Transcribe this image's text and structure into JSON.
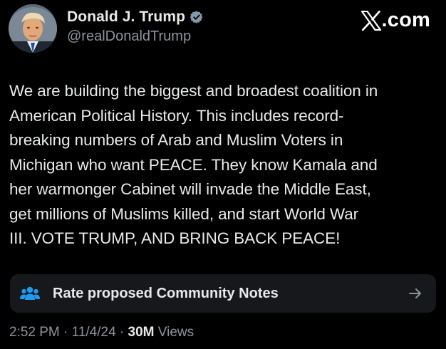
{
  "author": {
    "display_name": "Donald J. Trump",
    "handle": "@realDonaldTrump",
    "verified": true,
    "avatar_icon": "profile-photo"
  },
  "brand": {
    "label": ".com",
    "icon": "x-logo-icon"
  },
  "post": {
    "text": "We are building the biggest and broadest coalition in\nAmerican Political History. This includes record-\nbreaking numbers of Arab and Muslim Voters in\nMichigan who want PEACE. They know Kamala and\nher warmonger Cabinet will invade the Middle East,\nget millions of Muslims killed, and start World War\nIII. VOTE TRUMP, AND BRING BACK PEACE!"
  },
  "community_notes": {
    "label": "Rate proposed Community Notes",
    "icon": "people-icon",
    "arrow_icon": "arrow-right-icon",
    "accent_color": "#1d9bf0"
  },
  "meta": {
    "time": "2:52 PM",
    "separator": "·",
    "date": "11/4/24",
    "views_count": "30M",
    "views_label": "Views"
  },
  "colors": {
    "background": "#000000",
    "text_primary": "#e7e9ea",
    "text_secondary": "#8b949c",
    "verified_badge": "#829aab",
    "notes_bar": "#16181c"
  }
}
